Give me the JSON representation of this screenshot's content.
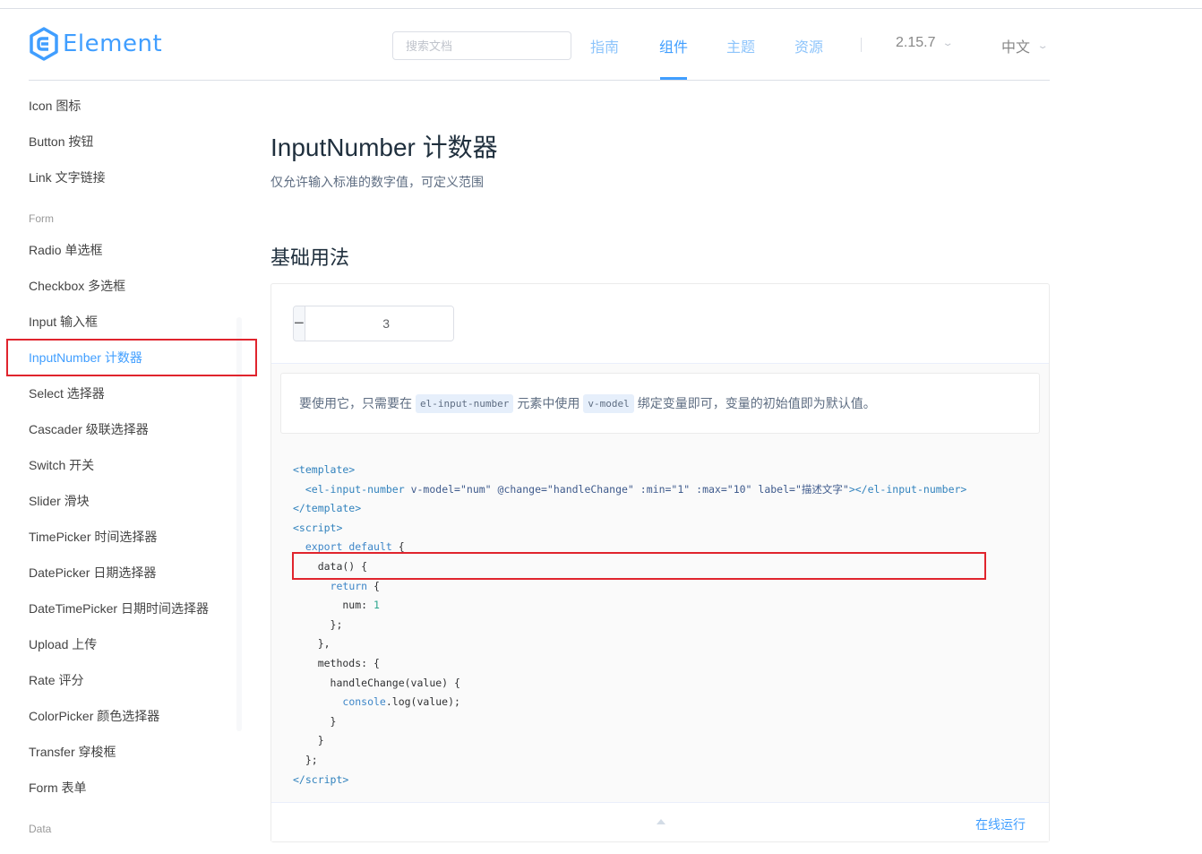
{
  "header": {
    "logo_text": "Element",
    "search_placeholder": "搜索文档",
    "nav": [
      {
        "label": "指南",
        "active": false
      },
      {
        "label": "组件",
        "active": true
      },
      {
        "label": "主题",
        "active": false
      },
      {
        "label": "资源",
        "active": false
      }
    ],
    "version": "2.15.7",
    "language": "中文"
  },
  "sidebar": {
    "items": [
      {
        "label": "Icon 图标"
      },
      {
        "label": "Button 按钮"
      },
      {
        "label": "Link 文字链接"
      }
    ],
    "groups": [
      {
        "title": "Form",
        "items": [
          {
            "label": "Radio 单选框"
          },
          {
            "label": "Checkbox 多选框"
          },
          {
            "label": "Input 输入框"
          },
          {
            "label": "InputNumber 计数器",
            "active": true
          },
          {
            "label": "Select 选择器"
          },
          {
            "label": "Cascader 级联选择器"
          },
          {
            "label": "Switch 开关"
          },
          {
            "label": "Slider 滑块"
          },
          {
            "label": "TimePicker 时间选择器"
          },
          {
            "label": "DatePicker 日期选择器"
          },
          {
            "label": "DateTimePicker 日期时间选择器"
          },
          {
            "label": "Upload 上传"
          },
          {
            "label": "Rate 评分"
          },
          {
            "label": "ColorPicker 颜色选择器"
          },
          {
            "label": "Transfer 穿梭框"
          },
          {
            "label": "Form 表单"
          }
        ]
      },
      {
        "title": "Data"
      }
    ]
  },
  "main": {
    "title": "InputNumber 计数器",
    "description": "仅允许输入标准的数字值，可定义范围",
    "section_title": "基础用法",
    "demo": {
      "input_value": "3",
      "decrease_symbol": "−",
      "increase_symbol": "+",
      "desc_before": "要使用它，只需要在",
      "desc_code1": "el-input-number",
      "desc_middle": "元素中使用",
      "desc_code2": "v-model",
      "desc_after": "绑定变量即可，变量的初始值即为默认值。",
      "run_online": "在线运行"
    }
  },
  "colors": {
    "accent": "#409eff",
    "highlight_border": "#e0242d"
  }
}
